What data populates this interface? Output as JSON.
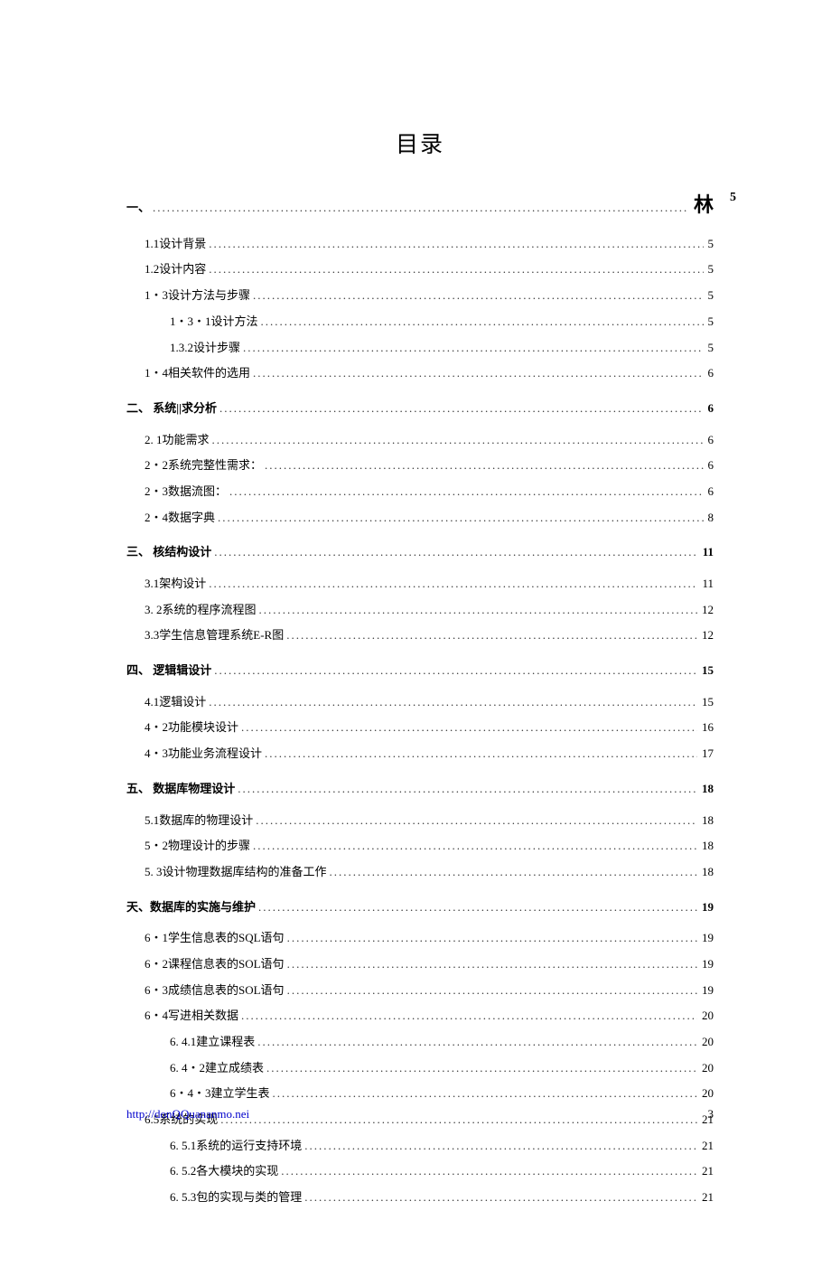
{
  "title": "目录",
  "entries": [
    {
      "indent": 0,
      "bold": true,
      "section": true,
      "first": true,
      "label": "一、",
      "page": "林",
      "bigEnd": true,
      "extraPage": "5"
    },
    {
      "indent": 1,
      "label": "1.1设计背景",
      "page": "5"
    },
    {
      "indent": 1,
      "label": "1.2设计内容",
      "page": "5"
    },
    {
      "indent": 1,
      "label": "1・3设计方法与步骤",
      "page": "5"
    },
    {
      "indent": 2,
      "label": "1・3・1设计方法",
      "page": "5"
    },
    {
      "indent": 2,
      "label": "1.3.2设计步骤",
      "page": "5"
    },
    {
      "indent": 1,
      "label": "1・4相关软件的选用",
      "page": "6"
    },
    {
      "indent": 0,
      "bold": true,
      "section": true,
      "label": "二、 系统||求分析",
      "page": "6"
    },
    {
      "indent": 1,
      "label": "2.  1功能需求",
      "page": "6"
    },
    {
      "indent": 1,
      "label": "2・2系统完整性需求：",
      "page": "6"
    },
    {
      "indent": 1,
      "label": "2・3数据流图：",
      "page": "6"
    },
    {
      "indent": 1,
      "label": "2・4数据字典",
      "page": "8"
    },
    {
      "indent": 0,
      "bold": true,
      "section": true,
      "label": "三、 核结构设计",
      "page": "11"
    },
    {
      "indent": 1,
      "label": "3.1架构设计",
      "page": "11"
    },
    {
      "indent": 1,
      "label": "3.  2系统的程序流程图",
      "page": "12"
    },
    {
      "indent": 1,
      "label": "3.3学生信息管理系统E-R图",
      "page": "12"
    },
    {
      "indent": 0,
      "bold": true,
      "section": true,
      "label": "四、 逻辑辑设计",
      "page": "15"
    },
    {
      "indent": 1,
      "label": "4.1逻辑设计",
      "page": "15"
    },
    {
      "indent": 1,
      "label": "4・2功能模块设计",
      "page": "16"
    },
    {
      "indent": 1,
      "label": "4・3功能业务流程设计",
      "page": "17"
    },
    {
      "indent": 0,
      "bold": true,
      "section": true,
      "label": "五、 数据库物理设计",
      "page": "18"
    },
    {
      "indent": 1,
      "label": "5.1数据库的物理设计",
      "page": "18"
    },
    {
      "indent": 1,
      "label": "5・2物理设计的步骤",
      "page": "18"
    },
    {
      "indent": 1,
      "label": "5.  3设计物理数据库结构的准备工作",
      "page": "18"
    },
    {
      "indent": 0,
      "bold": true,
      "section": true,
      "label": "天、数据库的实施与维护",
      "page": "19"
    },
    {
      "indent": 1,
      "label": "6・1学生信息表的SQL语句",
      "page": "19"
    },
    {
      "indent": 1,
      "label": "6・2课程信息表的SOL语句",
      "page": "19"
    },
    {
      "indent": 1,
      "label": "6・3成绩信息表的SOL语句",
      "page": "19"
    },
    {
      "indent": 1,
      "label": "6・4写进相关数据",
      "page": "20"
    },
    {
      "indent": 2,
      "label": "6.  4.1建立课程表",
      "page": "20"
    },
    {
      "indent": 2,
      "label": "6.  4・2建立成绩表",
      "page": "20"
    },
    {
      "indent": 2,
      "label": "6・4・3建立学生表",
      "page": "20"
    },
    {
      "indent": 1,
      "label": "6.5系统的实现",
      "page": "21"
    },
    {
      "indent": 2,
      "label": "6. 5.1系统的运行支持环境",
      "page": "21"
    },
    {
      "indent": 2,
      "label": "6. 5.2各大模块的实现",
      "page": "21"
    },
    {
      "indent": 2,
      "label": "6. 5.3包的实现与类的管理",
      "page": "21"
    }
  ],
  "footer": {
    "link": "http://donQQuananmo.nei",
    "pageNum": "3"
  }
}
